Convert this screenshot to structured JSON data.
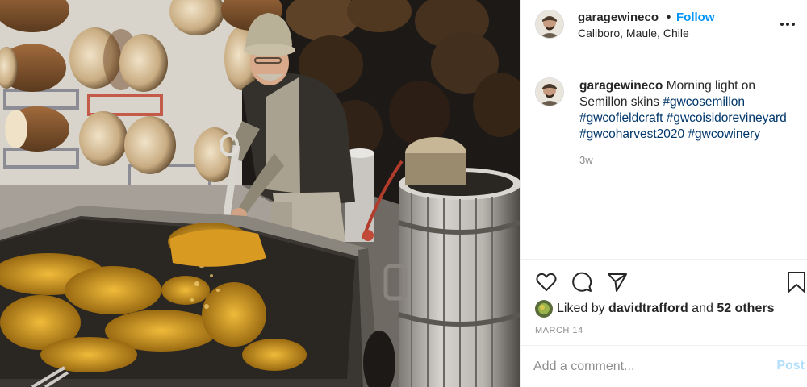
{
  "header": {
    "username": "garagewineco",
    "separator": "•",
    "follow_label": "Follow",
    "location": "Caliboro, Maule, Chile",
    "more_icon": "more-options-icon"
  },
  "caption": {
    "username": "garagewineco",
    "text": "Morning light on Semillon skins",
    "hashtags": [
      "#gwcosemillon",
      "#gwcofieldcraft",
      "#gwcoisidorevineyard",
      "#gwcoharvest2020",
      "#gwcowinery"
    ],
    "time": "3w"
  },
  "actions": {
    "icons": [
      "heart-icon",
      "comment-icon",
      "share-icon",
      "bookmark-icon"
    ]
  },
  "likes": {
    "prefix": "Liked by",
    "user": "davidtrafford",
    "joiner": "and",
    "others": "52 others"
  },
  "date": "MARCH 14",
  "comment": {
    "placeholder": "Add a comment...",
    "post_label": "Post"
  },
  "colors": {
    "link_blue": "#0095f6",
    "hashtag": "#00376b",
    "muted": "#8e8e8e",
    "post_disabled": "#b2dffc"
  }
}
